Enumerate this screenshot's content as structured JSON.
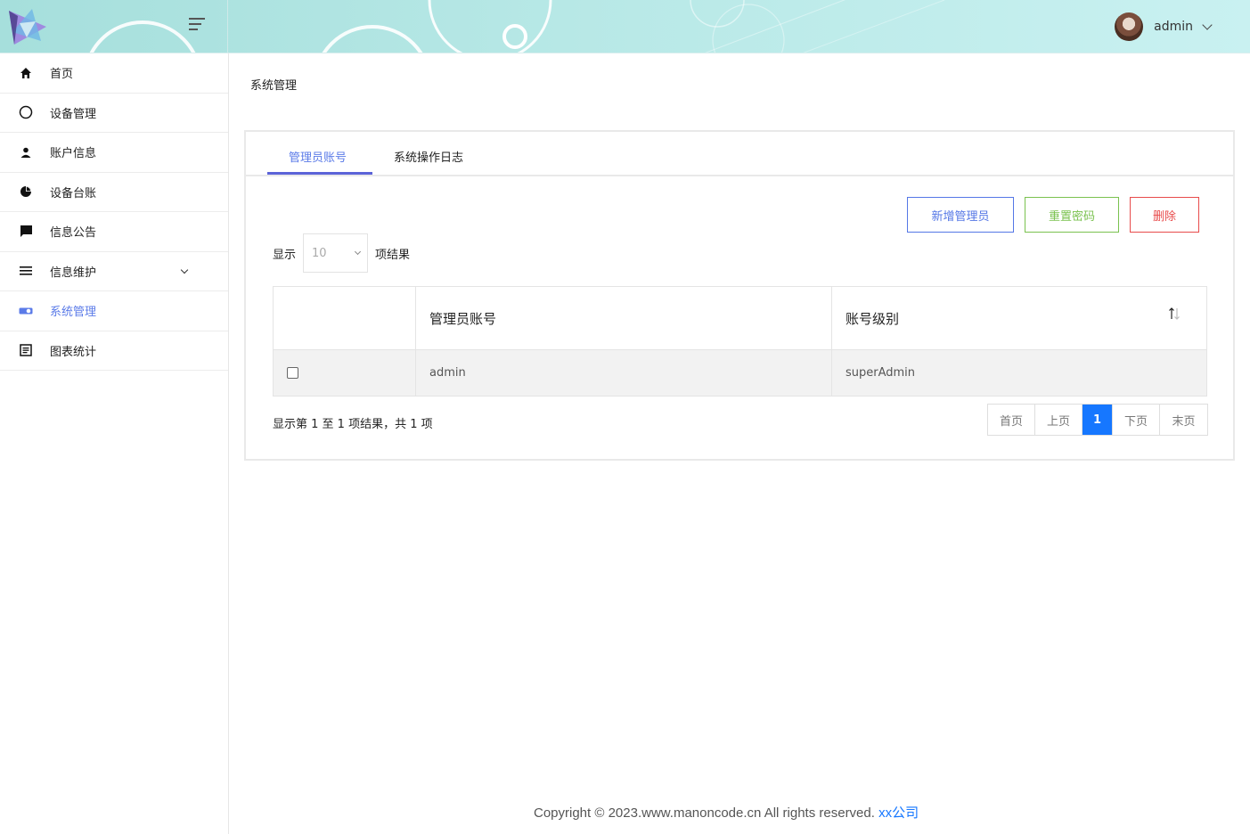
{
  "header": {
    "username": "admin"
  },
  "sidebar": {
    "items": [
      {
        "label": "首页",
        "icon": "home-icon"
      },
      {
        "label": "设备管理",
        "icon": "circle-icon"
      },
      {
        "label": "账户信息",
        "icon": "person-icon"
      },
      {
        "label": "设备台账",
        "icon": "pie-chart-icon"
      },
      {
        "label": "信息公告",
        "icon": "message-icon"
      },
      {
        "label": "信息维护",
        "icon": "list-icon"
      },
      {
        "label": "系统管理",
        "icon": "toggle-icon"
      },
      {
        "label": "图表统计",
        "icon": "document-icon"
      }
    ],
    "active_color": "#5b7be8"
  },
  "main": {
    "page_title": "系统管理",
    "tabs": [
      {
        "label": "管理员账号"
      },
      {
        "label": "系统操作日志"
      }
    ],
    "buttons": {
      "add": "新增管理员",
      "reset": "重置密码",
      "delete": "删除"
    },
    "show": {
      "prefix": "显示",
      "value": "10",
      "suffix": "项结果"
    },
    "table": {
      "headers": [
        "",
        "管理员账号",
        "账号级别"
      ],
      "rows": [
        {
          "account": "admin",
          "level": "superAdmin"
        }
      ]
    },
    "summary": "显示第 1 至 1 项结果，共 1 项",
    "pager": {
      "first": "首页",
      "prev": "上页",
      "current": "1",
      "next": "下页",
      "last": "末页"
    }
  },
  "footer": {
    "text": "Copyright © 2023.www.manoncode.cn All rights reserved.",
    "link": "xx公司"
  },
  "colors": {
    "primary": "#5577e6",
    "success": "#7ac24f",
    "danger": "#e84b4b",
    "pager_active": "#1677ff"
  }
}
